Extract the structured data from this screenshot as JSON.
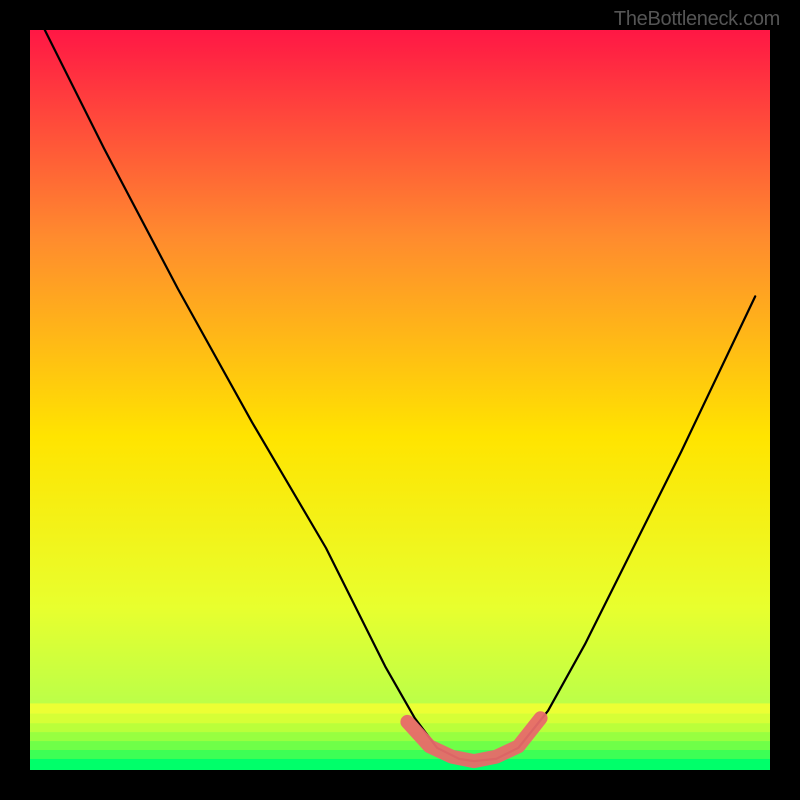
{
  "watermark": "TheBottleneck.com",
  "chart_data": {
    "type": "line",
    "title": "",
    "xlabel": "",
    "ylabel": "",
    "xlim": [
      0,
      100
    ],
    "ylim": [
      0,
      100
    ],
    "gradient": {
      "top": "#ff1745",
      "mid_upper": "#ff8b2e",
      "mid": "#ffe400",
      "mid_lower": "#e8ff2e",
      "near_bottom": "#b8ff4a",
      "bottom": "#00ff6a"
    },
    "series": [
      {
        "name": "bottleneck-curve",
        "x": [
          2,
          10,
          20,
          30,
          40,
          48,
          52,
          55,
          58,
          60,
          63,
          66,
          70,
          75,
          80,
          88,
          98
        ],
        "y": [
          100,
          84,
          65,
          47,
          30,
          14,
          7,
          3,
          1.5,
          1.2,
          1.5,
          3,
          8,
          17,
          27,
          43,
          64
        ],
        "color": "#000000"
      }
    ],
    "highlight_segment": {
      "name": "optimal-zone",
      "x": [
        51,
        54,
        57,
        60,
        63,
        66,
        69
      ],
      "y": [
        6.5,
        3.2,
        1.8,
        1.2,
        1.8,
        3.2,
        7.0
      ],
      "color": "#e86a6a",
      "width": 14
    },
    "bottom_bands": [
      {
        "y": 0.0,
        "h": 1.5,
        "color": "#00ff6a"
      },
      {
        "y": 1.5,
        "h": 1.2,
        "color": "#3dff55"
      },
      {
        "y": 2.7,
        "h": 1.2,
        "color": "#6fff48"
      },
      {
        "y": 3.9,
        "h": 1.2,
        "color": "#98ff40"
      },
      {
        "y": 5.1,
        "h": 1.2,
        "color": "#baff3a"
      },
      {
        "y": 6.3,
        "h": 1.3,
        "color": "#d6ff36"
      },
      {
        "y": 7.6,
        "h": 1.4,
        "color": "#ecff34"
      }
    ]
  }
}
